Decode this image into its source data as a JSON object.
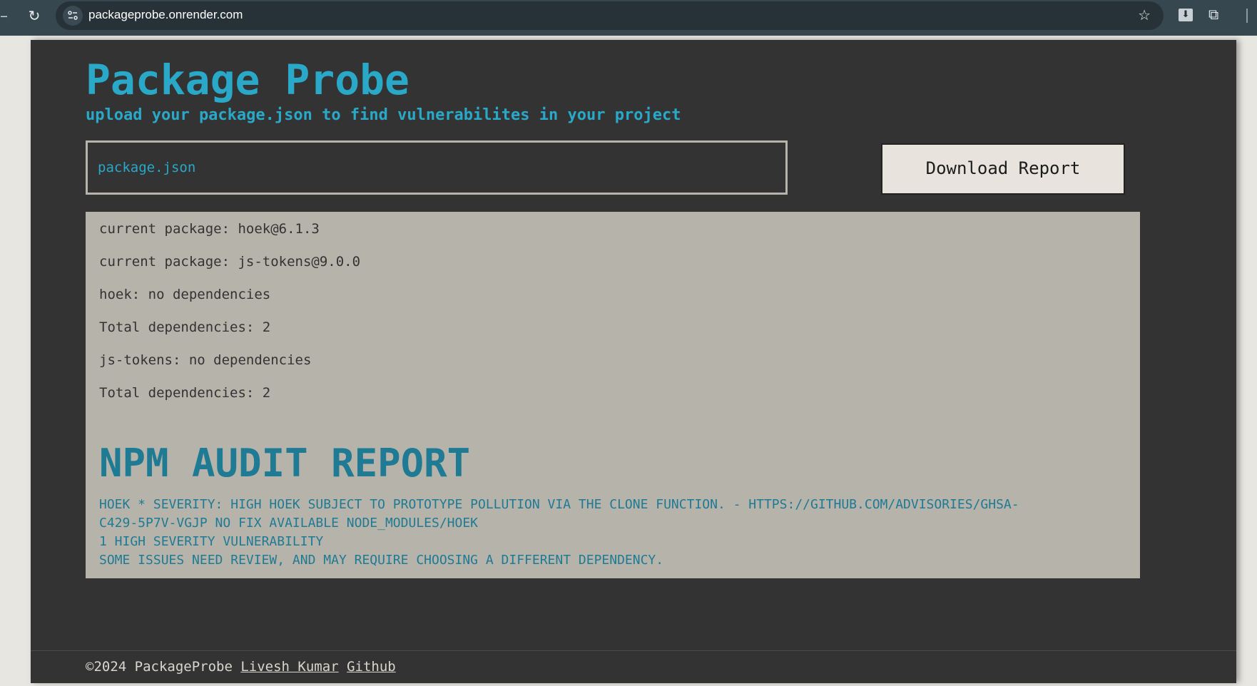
{
  "browser": {
    "url": "packageprobe.onrender.com"
  },
  "header": {
    "title": "Package Probe",
    "subtitle": "upload your package.json to find vulnerabilites in your project"
  },
  "upload": {
    "file_name": "package.json"
  },
  "actions": {
    "download_label": "Download Report"
  },
  "results": {
    "lines": [
      "current package: hoek@6.1.3",
      "current package: js-tokens@9.0.0",
      "hoek: no dependencies",
      "Total dependencies: 2",
      "js-tokens: no dependencies",
      "Total dependencies: 2"
    ],
    "audit_heading": "NPM AUDIT REPORT",
    "audit_lines": [
      "HOEK * SEVERITY: HIGH HOEK SUBJECT TO PROTOTYPE POLLUTION VIA THE CLONE FUNCTION. - HTTPS://GITHUB.COM/ADVISORIES/GHSA-",
      "C429-5P7V-VGJP NO FIX AVAILABLE NODE_MODULES/HOEK",
      "1 HIGH SEVERITY VULNERABILITY",
      "SOME ISSUES NEED REVIEW, AND MAY REQUIRE CHOOSING A DIFFERENT DEPENDENCY."
    ]
  },
  "footer": {
    "copyright": "©2024 PackageProbe",
    "author_link": "Livesh Kumar",
    "github_link": "Github"
  },
  "colors": {
    "accent": "#2aa8c8",
    "audit": "#1f7a93",
    "page_bg": "#333333",
    "results_bg": "#b6b3ab"
  },
  "icons": {
    "reload": "reload-icon",
    "site_info": "site-info-icon",
    "bookmark": "star-icon",
    "download": "download-icon",
    "extensions": "puzzle-icon"
  }
}
